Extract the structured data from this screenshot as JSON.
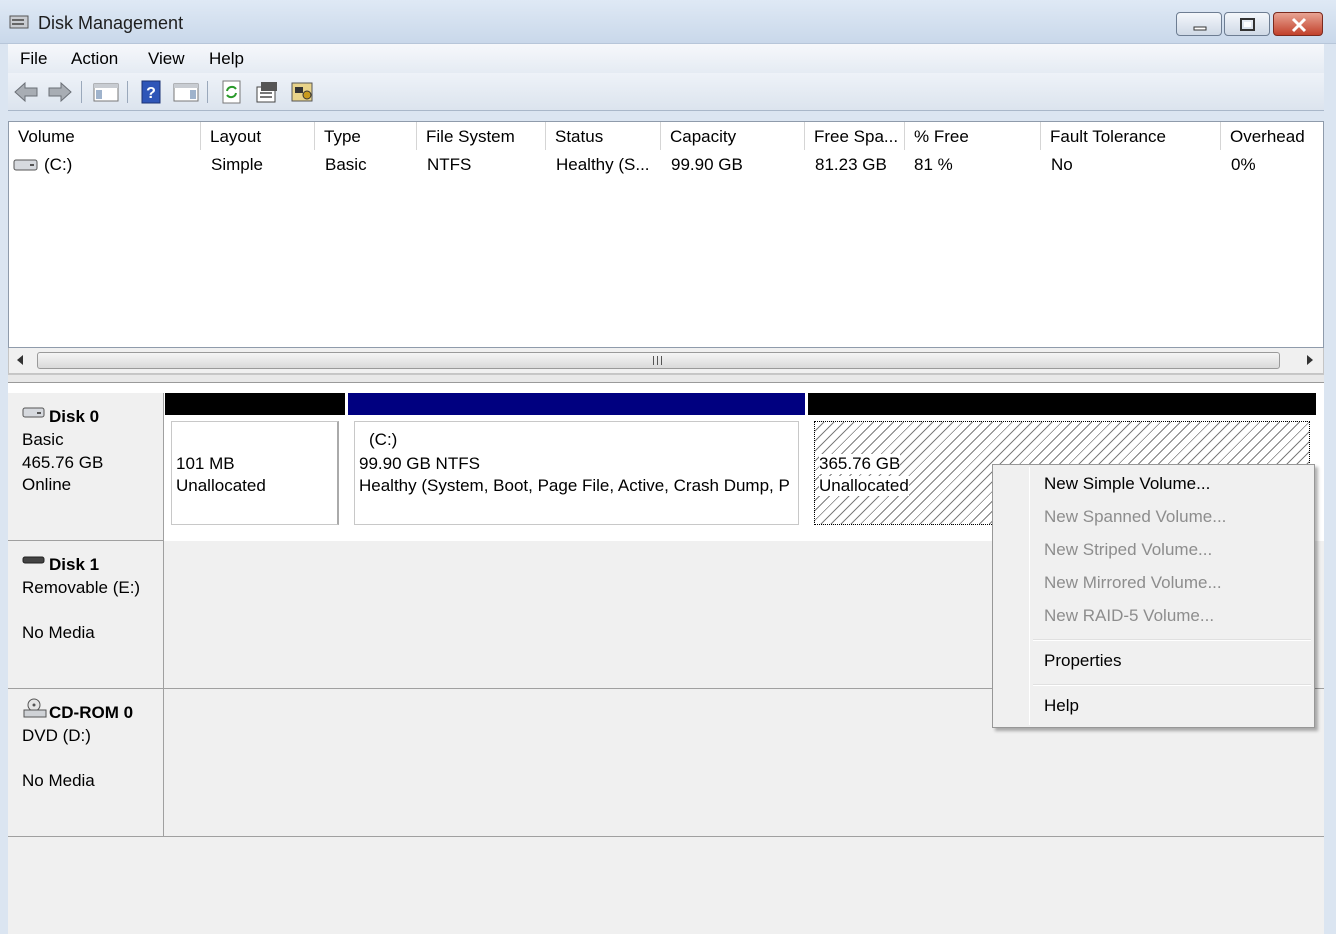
{
  "window": {
    "title": "Disk Management"
  },
  "menu": [
    "File",
    "Action",
    "View",
    "Help"
  ],
  "toolbar": {
    "icons": [
      "back-arrow-icon",
      "forward-arrow-icon",
      "console-tree-icon",
      "help-icon",
      "action-pane-icon",
      "refresh-icon",
      "properties-icon",
      "settings-icon"
    ]
  },
  "volume_list": {
    "columns": [
      "Volume",
      "Layout",
      "Type",
      "File System",
      "Status",
      "Capacity",
      "Free Spa...",
      "% Free",
      "Fault Tolerance",
      "Overhead"
    ],
    "rows": [
      {
        "volume": "(C:)",
        "layout": "Simple",
        "type": "Basic",
        "file_system": "NTFS",
        "status": "Healthy (S...",
        "capacity": "99.90 GB",
        "free_space": "81.23 GB",
        "percent_free": "81 %",
        "fault_tolerance": "No",
        "overhead": "0%"
      }
    ]
  },
  "disks": [
    {
      "name": "Disk 0",
      "lines": [
        "Basic",
        "465.76 GB",
        "Online"
      ],
      "partitions": [
        {
          "size": "101 MB",
          "status": "Unallocated"
        },
        {
          "label": "(C:)",
          "size": "99.90 GB NTFS",
          "status": "Healthy (System, Boot, Page File, Active, Crash Dump, P"
        },
        {
          "size": "365.76 GB",
          "status": "Unallocated"
        }
      ]
    },
    {
      "name": "Disk 1",
      "lines": [
        "Removable (E:)",
        "",
        "No Media"
      ]
    },
    {
      "name": "CD-ROM 0",
      "lines": [
        "DVD (D:)",
        "",
        "No Media"
      ]
    }
  ],
  "context_menu": {
    "items": [
      {
        "label": "New Simple Volume...",
        "enabled": true
      },
      {
        "label": "New Spanned Volume...",
        "enabled": false
      },
      {
        "label": "New Striped Volume...",
        "enabled": false
      },
      {
        "label": "New Mirrored Volume...",
        "enabled": false
      },
      {
        "label": "New RAID-5 Volume...",
        "enabled": false
      },
      {
        "label": "Properties",
        "enabled": true
      },
      {
        "label": "Help",
        "enabled": true
      }
    ]
  },
  "colors": {
    "primary_partition_bar": "#000080",
    "unallocated_bar": "#000000",
    "disabled_text": "#8d8d8d"
  }
}
